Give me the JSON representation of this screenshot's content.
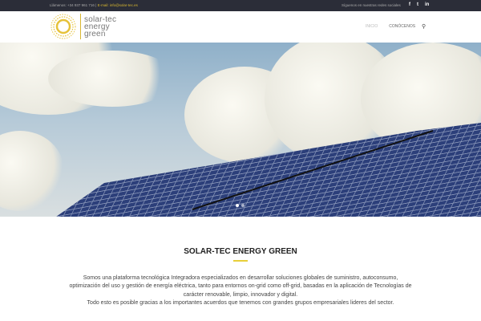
{
  "topbar": {
    "phone": "Llámenos: +34 937 961 716",
    "separator": " | ",
    "email": "E-mail: info@solar-tec.es",
    "social_label": "Síguenos en nuestras redes sociales",
    "icons": [
      "facebook-icon",
      "twitter-icon",
      "linkedin-icon"
    ]
  },
  "logo": {
    "line1": "solar-tec",
    "line2": "energy",
    "line3": "green"
  },
  "nav": {
    "items": [
      {
        "label": "INICIO"
      },
      {
        "label": "CONÓCENOS"
      }
    ]
  },
  "slider": {
    "slides": 2,
    "active": 1
  },
  "section": {
    "title": "SOLAR-TEC ENERGY GREEN",
    "lines": [
      "Somos una plataforma tecnológica Integradora especializados en desarrollar soluciones globales de suministro, autoconsumo,",
      "optimización del uso y gestión de energía eléctrica, tanto para entornos on-grid como off-grid, basadas en la aplicación de Tecnologías de",
      "carácter renovable, limpio, innovador y digital.",
      "Todo esto es posible gracias a los importantes acuerdos que tenemos con grandes grupos empresariales lideres del sector."
    ]
  },
  "colors": {
    "accent": "#e8cf3a",
    "topbar": "#2b2d38"
  }
}
